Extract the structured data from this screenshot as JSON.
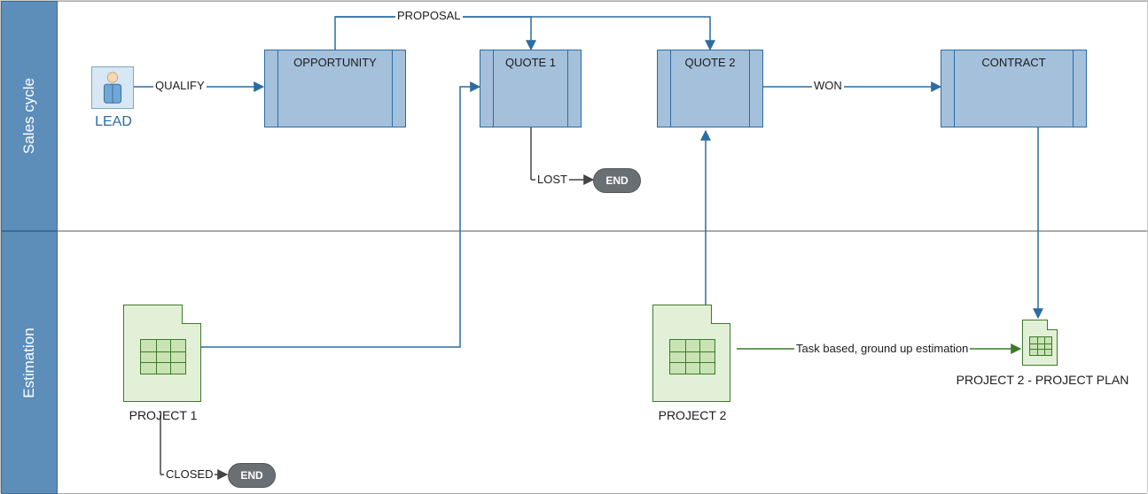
{
  "lanes": {
    "sales": "Sales cycle",
    "estimation": "Estimation"
  },
  "nodes": {
    "lead": "LEAD",
    "opportunity": "OPPORTUNITY",
    "quote1": "QUOTE 1",
    "quote2": "QUOTE 2",
    "contract": "CONTRACT",
    "end1": "END",
    "end2": "END",
    "project1": "PROJECT 1",
    "project2": "PROJECT 2",
    "project2plan": "PROJECT 2 - PROJECT PLAN"
  },
  "edges": {
    "qualify": "QUALIFY",
    "proposal": "PROPOSAL",
    "lost": "LOST",
    "won": "WON",
    "closed": "CLOSED",
    "taskbased": "Task based, ground up estimation"
  }
}
